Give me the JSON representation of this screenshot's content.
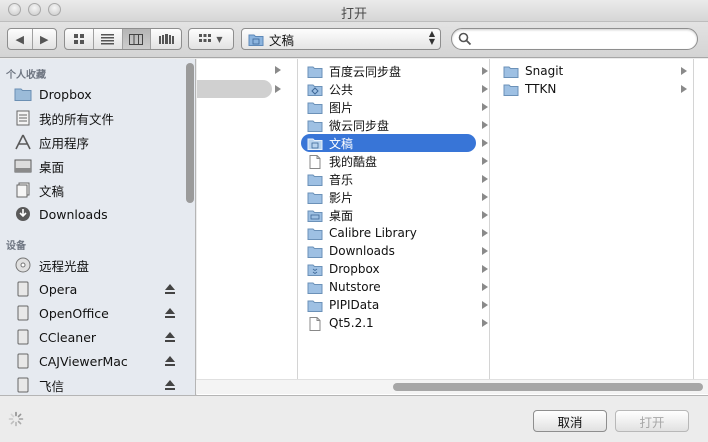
{
  "window": {
    "title": "打开"
  },
  "toolbar": {
    "location": "文稿",
    "search_placeholder": ""
  },
  "sidebar": {
    "favorites_header": "个人收藏",
    "favorites": [
      {
        "label": "Dropbox",
        "icon": "folder-icon"
      },
      {
        "label": "我的所有文件",
        "icon": "all-files-icon"
      },
      {
        "label": "应用程序",
        "icon": "applications-icon"
      },
      {
        "label": "桌面",
        "icon": "desktop-icon"
      },
      {
        "label": "文稿",
        "icon": "documents-icon"
      },
      {
        "label": "Downloads",
        "icon": "downloads-icon"
      }
    ],
    "devices_header": "设备",
    "devices": [
      {
        "label": "远程光盘",
        "icon": "disc-icon"
      },
      {
        "label": "Opera",
        "icon": "drive-icon"
      },
      {
        "label": "OpenOffice",
        "icon": "drive-icon"
      },
      {
        "label": "CCleaner",
        "icon": "drive-icon"
      },
      {
        "label": "CAJViewerMac",
        "icon": "drive-icon"
      },
      {
        "label": "飞信",
        "icon": "drive-icon"
      }
    ]
  },
  "columns": {
    "col2": [
      {
        "label": "百度云同步盘",
        "icon": "folder-icon"
      },
      {
        "label": "公共",
        "icon": "public-folder-icon"
      },
      {
        "label": "图片",
        "icon": "folder-icon"
      },
      {
        "label": "微云同步盘",
        "icon": "folder-icon"
      },
      {
        "label": "文稿",
        "icon": "documents-folder-icon",
        "selected": true
      },
      {
        "label": "我的酷盘",
        "icon": "file-icon"
      },
      {
        "label": "音乐",
        "icon": "folder-icon"
      },
      {
        "label": "影片",
        "icon": "folder-icon"
      },
      {
        "label": "桌面",
        "icon": "desktop-folder-icon"
      },
      {
        "label": "Calibre Library",
        "icon": "folder-icon"
      },
      {
        "label": "Downloads",
        "icon": "folder-icon"
      },
      {
        "label": "Dropbox",
        "icon": "dropbox-folder-icon"
      },
      {
        "label": "Nutstore",
        "icon": "folder-icon"
      },
      {
        "label": "PIPIData",
        "icon": "folder-icon"
      },
      {
        "label": "Qt5.2.1",
        "icon": "file-icon"
      }
    ],
    "col3": [
      {
        "label": "Snagit",
        "icon": "folder-icon"
      },
      {
        "label": "TTKN",
        "icon": "folder-icon"
      }
    ]
  },
  "buttons": {
    "cancel": "取消",
    "open": "打开"
  }
}
